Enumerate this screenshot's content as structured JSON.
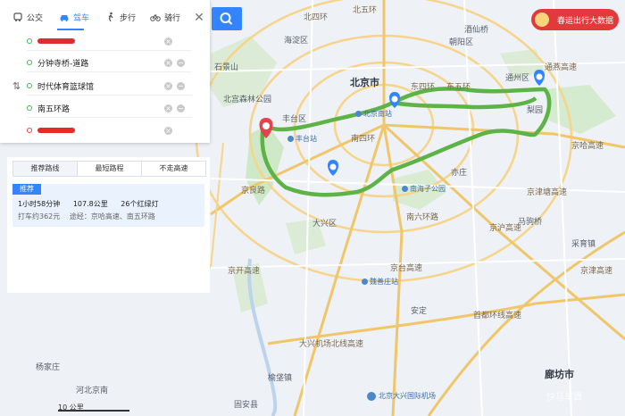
{
  "modes": [
    {
      "label": "公交",
      "icon": "bus-icon"
    },
    {
      "label": "驾车",
      "icon": "car-icon",
      "active": true
    },
    {
      "label": "步行",
      "icon": "walk-icon"
    },
    {
      "label": "骑行",
      "icon": "bike-icon"
    }
  ],
  "stops": [
    {
      "value": "",
      "redacted": true
    },
    {
      "value": "分钟寺桥-道路"
    },
    {
      "value": "时代体育篮球馆"
    },
    {
      "value": "南五环路"
    },
    {
      "value": "",
      "redacted": true
    }
  ],
  "result": {
    "tabs": [
      "推荐路线",
      "最短路程",
      "不走高速"
    ],
    "badge": "推荐",
    "duration": "1小时58分钟",
    "distance": "107.8公里",
    "lights": "26个红绿灯",
    "taxi": "打车约362元",
    "via": "途经：京哈高速、南五环路"
  },
  "promo": "春运出行大数据",
  "scale": "10 公里",
  "watermark": "快马车谭",
  "route_color": "#5db346",
  "accent": "#3385ff",
  "map": {
    "cities": {
      "beijing": "北京市",
      "langfang": "廊坊市"
    },
    "districts": {
      "haidian": "海淀区",
      "fengtai": "丰台区",
      "daxing": "大兴区",
      "tongzhou": "通州区",
      "chaoyang": "朝阳区"
    },
    "roads": {
      "north4": "北四环",
      "north5": "北五环",
      "east4": "东四环",
      "east5": "东五环",
      "south4": "南四环",
      "south6": "南六环路",
      "jingliang": "京良路",
      "jinghu": "京沪高速",
      "jingha": "京哈高速",
      "jingtai": "京台高速",
      "jingkai": "京开高速",
      "jinghu2": "京津高速",
      "daxing_airport_exp": "大兴机场北线高速",
      "airport_ring": "首都环线高速",
      "tongyan": "通燕高速",
      "zhuanjing": "京津塘高速"
    },
    "places": {
      "nanyuan": "南海子公园",
      "beijing_south": "北京南站",
      "fengtai_station": "丰台站",
      "weishan": "魏善庄站",
      "anding": "安定",
      "yizhuang": "亦庄",
      "daxing_airport": "北京大兴国际机场",
      "gu_an": "固安县",
      "xiaozhi": "河北京南",
      "shijingshan": "石景山",
      "majuqiao": "马驹桥",
      "jiuxianqiao": "酒仙桥",
      "yangjiazhuang": "杨家庄",
      "caiyu": "采育镇",
      "yufa": "榆垡镇",
      "liyuan": "梨园",
      "beigong": "北宫森林公园"
    }
  }
}
